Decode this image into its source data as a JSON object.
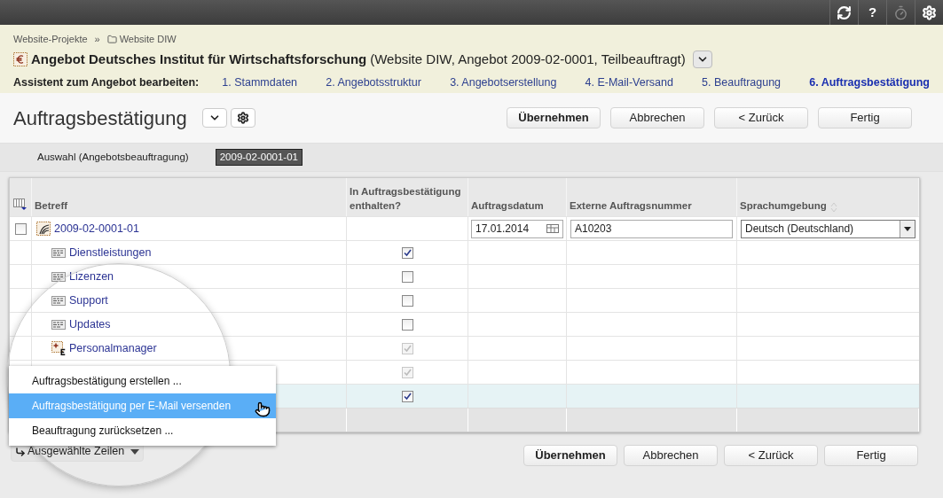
{
  "topbar": {
    "help_label": "?"
  },
  "breadcrumb": [
    {
      "label": "Website-Projekte",
      "kind": "link"
    },
    {
      "label": "»",
      "kind": "separator"
    },
    {
      "label": "Website DIW",
      "kind": "folder"
    }
  ],
  "header": {
    "title": "Angebot Deutsches Institut für Wirtschaftsforschung",
    "detail": "(Website DIW, Angebot 2009-02-0001, Teilbeauftragt)"
  },
  "wizard": {
    "label": "Assistent zum Angebot bearbeiten:",
    "steps": [
      {
        "label": "1. Stammdaten",
        "selected": false
      },
      {
        "label": "2. Angebotsstruktur",
        "selected": false
      },
      {
        "label": "3. Angebotserstellung",
        "selected": false
      },
      {
        "label": "4. E-Mail-Versand",
        "selected": false
      },
      {
        "label": "5. Beauftragung",
        "selected": false
      },
      {
        "label": "6. Auftragsbestätigung",
        "selected": true
      }
    ]
  },
  "page_title": "Auftragsbestätigung",
  "top_buttons": [
    {
      "label": "Übernehmen",
      "primary": true
    },
    {
      "label": "Abbrechen",
      "primary": false
    },
    {
      "label": "< Zurück",
      "primary": false
    },
    {
      "label": "Fertig",
      "primary": false
    }
  ],
  "selection": {
    "label": "Auswahl (Angebotsbeauftragung)",
    "value": "2009-02-0001-01"
  },
  "table": {
    "columns": [
      "Betreff",
      "In Auftragsbestätigung enthalten?",
      "Auftragsdatum",
      "Externe Auftragsnummer",
      "Sprachumgebung"
    ],
    "rows": [
      {
        "kind": "parent",
        "checked": false,
        "betreff": "2009-02-0001-01",
        "date": "17.01.2014",
        "ext": "A10203",
        "language": "Deutsch (Deutschland)",
        "selected": false
      },
      {
        "kind": "module",
        "betreff": "Dienstleistungen",
        "included": true,
        "disabled": false,
        "selected": false
      },
      {
        "kind": "module",
        "betreff": "Lizenzen",
        "included": false,
        "disabled": false,
        "selected": false
      },
      {
        "kind": "module",
        "betreff": "Support",
        "included": false,
        "disabled": false,
        "selected": false
      },
      {
        "kind": "module",
        "betreff": "Updates",
        "included": false,
        "disabled": false,
        "selected": false
      },
      {
        "kind": "product",
        "betreff": "Personalmanager",
        "included": true,
        "disabled": true,
        "selected": false
      },
      {
        "kind": "hidden",
        "included": true,
        "disabled": true,
        "selected": false
      },
      {
        "kind": "hidden",
        "included": true,
        "disabled": false,
        "selected": true
      }
    ]
  },
  "menu": [
    {
      "label": "Auftragsbestätigung erstellen ...",
      "selected": false
    },
    {
      "label": "Auftragsbestätigung per E-Mail versenden",
      "selected": true
    },
    {
      "label": "Beauftragung zurücksetzen ...",
      "selected": false
    }
  ],
  "rows_button": "Ausgewählte Zeilen",
  "bottom_buttons": [
    {
      "label": "Übernehmen",
      "primary": true
    },
    {
      "label": "Abbrechen",
      "primary": false
    },
    {
      "label": "< Zurück",
      "primary": false
    },
    {
      "label": "Fertig",
      "primary": false
    }
  ]
}
